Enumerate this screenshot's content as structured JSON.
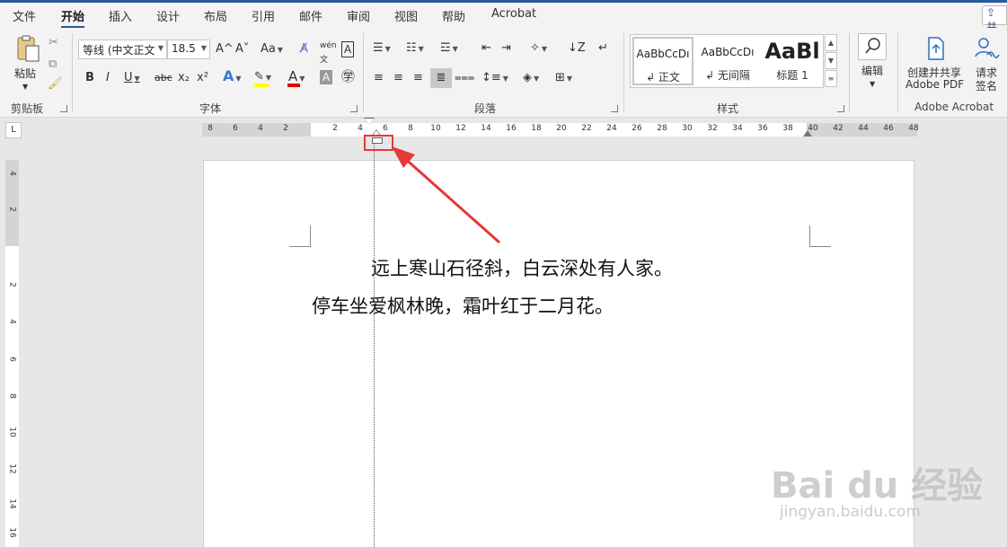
{
  "tabs": [
    "文件",
    "开始",
    "插入",
    "设计",
    "布局",
    "引用",
    "邮件",
    "审阅",
    "视图",
    "帮助",
    "Acrobat"
  ],
  "active_tab": "开始",
  "share_label": "共",
  "clipboard": {
    "paste_label": "粘贴",
    "group_label": "剪贴板"
  },
  "font": {
    "family": "等线 (中文正文",
    "size": "18.5",
    "group_label": "字体",
    "grow": "A^",
    "shrink": "A˅",
    "case": "Aa",
    "bold": "B",
    "italic": "I",
    "underline": "U",
    "strike": "abc",
    "subscript": "x₂",
    "superscript": "x²",
    "phonetic": "wén",
    "char_shading": "A",
    "font_color_letter": "A",
    "font_color": "#e00000",
    "highlight_color": "#ffff00"
  },
  "paragraph": {
    "group_label": "段落"
  },
  "styles": {
    "group_label": "样式",
    "items": [
      {
        "sample": "AaBbCcDı",
        "name": "↲ 正文"
      },
      {
        "sample": "AaBbCcDı",
        "name": "↲ 无间隔"
      },
      {
        "sample": "AaBl",
        "name": "标题 1"
      }
    ]
  },
  "editing": {
    "label": "编辑"
  },
  "adobe": {
    "create_line1": "创建并共享",
    "create_line2": "Adobe PDF",
    "request_line1": "请求",
    "request_line2": "签名",
    "group_label": "Adobe Acrobat"
  },
  "ruler": {
    "left_numbers": [
      "8",
      "6",
      "4",
      "2"
    ],
    "main_numbers": [
      "2",
      "4",
      "6",
      "8",
      "10",
      "12",
      "14",
      "16",
      "18",
      "20",
      "22",
      "24",
      "26",
      "28",
      "30",
      "32",
      "34",
      "36",
      "38",
      "40"
    ],
    "right_numbers": [
      "42",
      "44",
      "46",
      "48"
    ],
    "corner": "L",
    "vertical_numbers": [
      "4",
      "2",
      "2",
      "4",
      "6",
      "8",
      "10",
      "12",
      "14",
      "16"
    ]
  },
  "document": {
    "line1": "远上寒山石径斜，白云深处有人家。",
    "line2": "停车坐爱枫林晚，霜叶红于二月花。"
  },
  "colors": {
    "accent": "#2b579a",
    "annotation": "#e53935"
  },
  "watermark": {
    "main": "Bai du 经验",
    "sub": "jingyan.baidu.com"
  }
}
